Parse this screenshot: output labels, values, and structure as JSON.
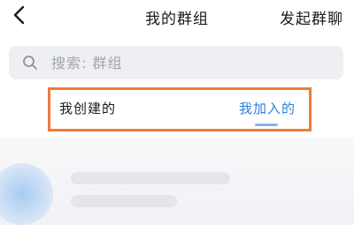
{
  "header": {
    "title": "我的群组",
    "action_label": "发起群聊"
  },
  "search": {
    "placeholder": "搜索: 群组",
    "value": ""
  },
  "tabs": [
    {
      "label": "我创建的",
      "active": false
    },
    {
      "label": "我加入的",
      "active": true
    }
  ],
  "colors": {
    "accent": "#2f7fd7",
    "highlight_border": "#ef7a3d",
    "search_bg": "#eeeff2"
  },
  "icons": {
    "back": "chevron-left-icon",
    "search": "search-icon"
  }
}
